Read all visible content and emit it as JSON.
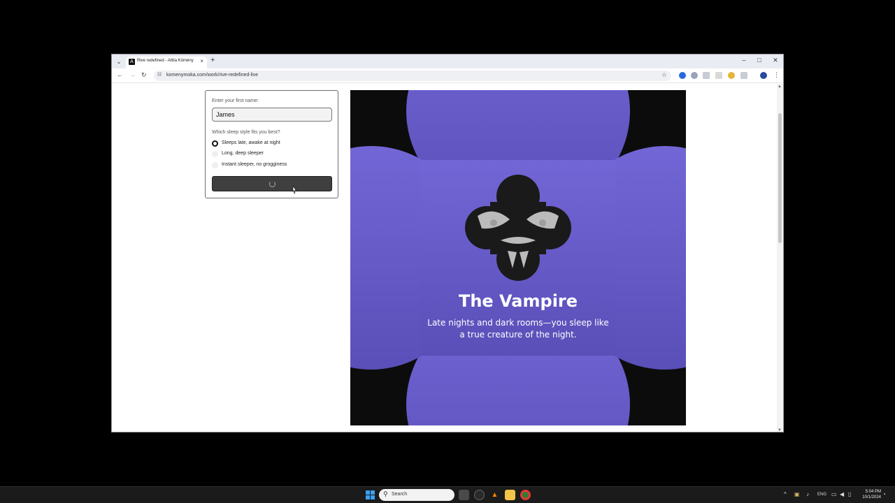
{
  "browser": {
    "tab_title": "Rive redefined - Attila Kömény",
    "tab_favicon": "A",
    "url": "komenymoka.com/work/rive-redefined-live",
    "new_tab_icon": "+",
    "close_tab_icon": "×"
  },
  "form": {
    "name_label": "Enter your first name:",
    "name_value": "James",
    "sleep_label": "Which sleep style fits you best?",
    "options": [
      {
        "label": "Sleeps late, awake at night",
        "selected": true
      },
      {
        "label": "Long, deep sleeper",
        "selected": false
      },
      {
        "label": "Instant sleeper, no grogginess",
        "selected": false
      }
    ],
    "submit_state": "loading"
  },
  "result": {
    "title": "The Vampire",
    "description": "Late nights and dark rooms—you sleep like a true creature of the night.",
    "background_color": "#6a5fcf",
    "card_color": "#0c0c0c"
  },
  "taskbar": {
    "search_placeholder": "Search",
    "language": "ENG",
    "time": "5:04 PM",
    "date": "10/1/2024"
  }
}
